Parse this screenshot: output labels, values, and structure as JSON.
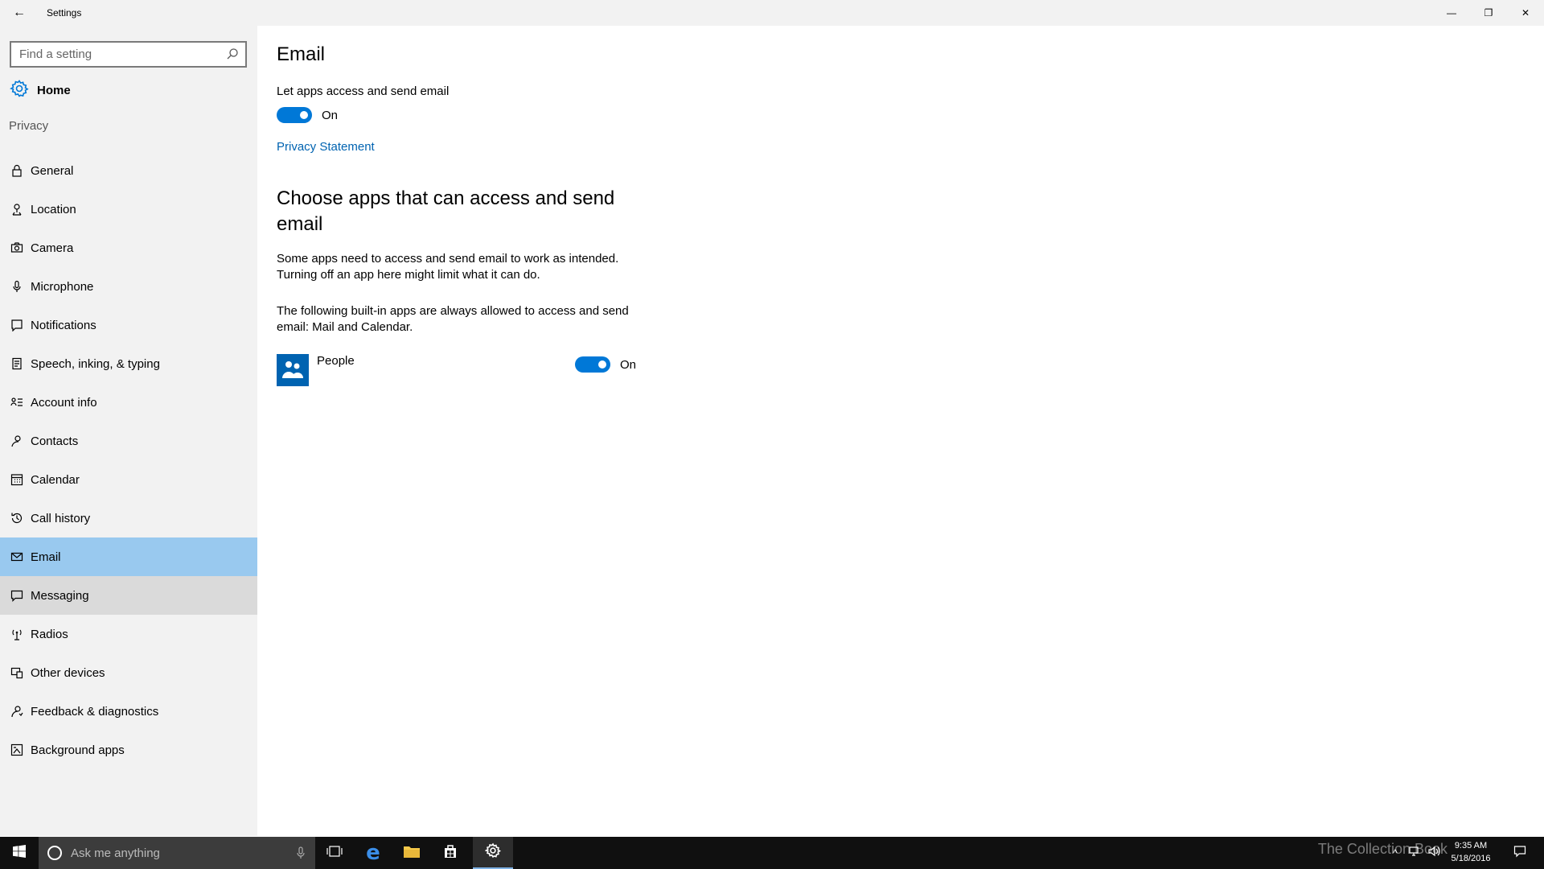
{
  "window": {
    "title": "Settings",
    "back_glyph": "←",
    "minimize_glyph": "—",
    "restore_glyph": "❐",
    "close_glyph": "✕"
  },
  "sidebar": {
    "search_placeholder": "Find a setting",
    "home_label": "Home",
    "section_label": "Privacy",
    "items": [
      {
        "label": "General",
        "icon": "lock-icon"
      },
      {
        "label": "Location",
        "icon": "location-icon"
      },
      {
        "label": "Camera",
        "icon": "camera-icon"
      },
      {
        "label": "Microphone",
        "icon": "microphone-icon"
      },
      {
        "label": "Notifications",
        "icon": "notifications-icon"
      },
      {
        "label": "Speech, inking, & typing",
        "icon": "speech-icon"
      },
      {
        "label": "Account info",
        "icon": "account-info-icon"
      },
      {
        "label": "Contacts",
        "icon": "contacts-icon"
      },
      {
        "label": "Calendar",
        "icon": "calendar-icon"
      },
      {
        "label": "Call history",
        "icon": "call-history-icon"
      },
      {
        "label": "Email",
        "icon": "email-icon",
        "state": "selected"
      },
      {
        "label": "Messaging",
        "icon": "messaging-icon",
        "state": "hover"
      },
      {
        "label": "Radios",
        "icon": "radios-icon"
      },
      {
        "label": "Other devices",
        "icon": "other-devices-icon"
      },
      {
        "label": "Feedback & diagnostics",
        "icon": "feedback-icon"
      },
      {
        "label": "Background apps",
        "icon": "background-apps-icon"
      }
    ]
  },
  "main": {
    "title": "Email",
    "master_setting_label": "Let apps access and send email",
    "master_toggle_state": "On",
    "privacy_link": "Privacy Statement",
    "choose_heading": "Choose apps that can access and send email",
    "description_1": "Some apps need to access and send email to work as intended. Turning off an app here might limit what it can do.",
    "description_2": "The following built-in apps are always allowed to access and send email: Mail and Calendar.",
    "apps": [
      {
        "name": "People",
        "state": "On",
        "icon": "people-icon"
      }
    ]
  },
  "taskbar": {
    "search_placeholder": "Ask me anything",
    "time": "9:35 AM",
    "date": "5/18/2016",
    "watermark": "The Collection Book"
  },
  "colors": {
    "accent": "#0078d7",
    "selected_nav": "#99c9ef",
    "hover_nav": "#dadada",
    "sidebar_bg": "#f2f2f2",
    "link": "#0063b1",
    "taskbar_bg": "#101010"
  }
}
